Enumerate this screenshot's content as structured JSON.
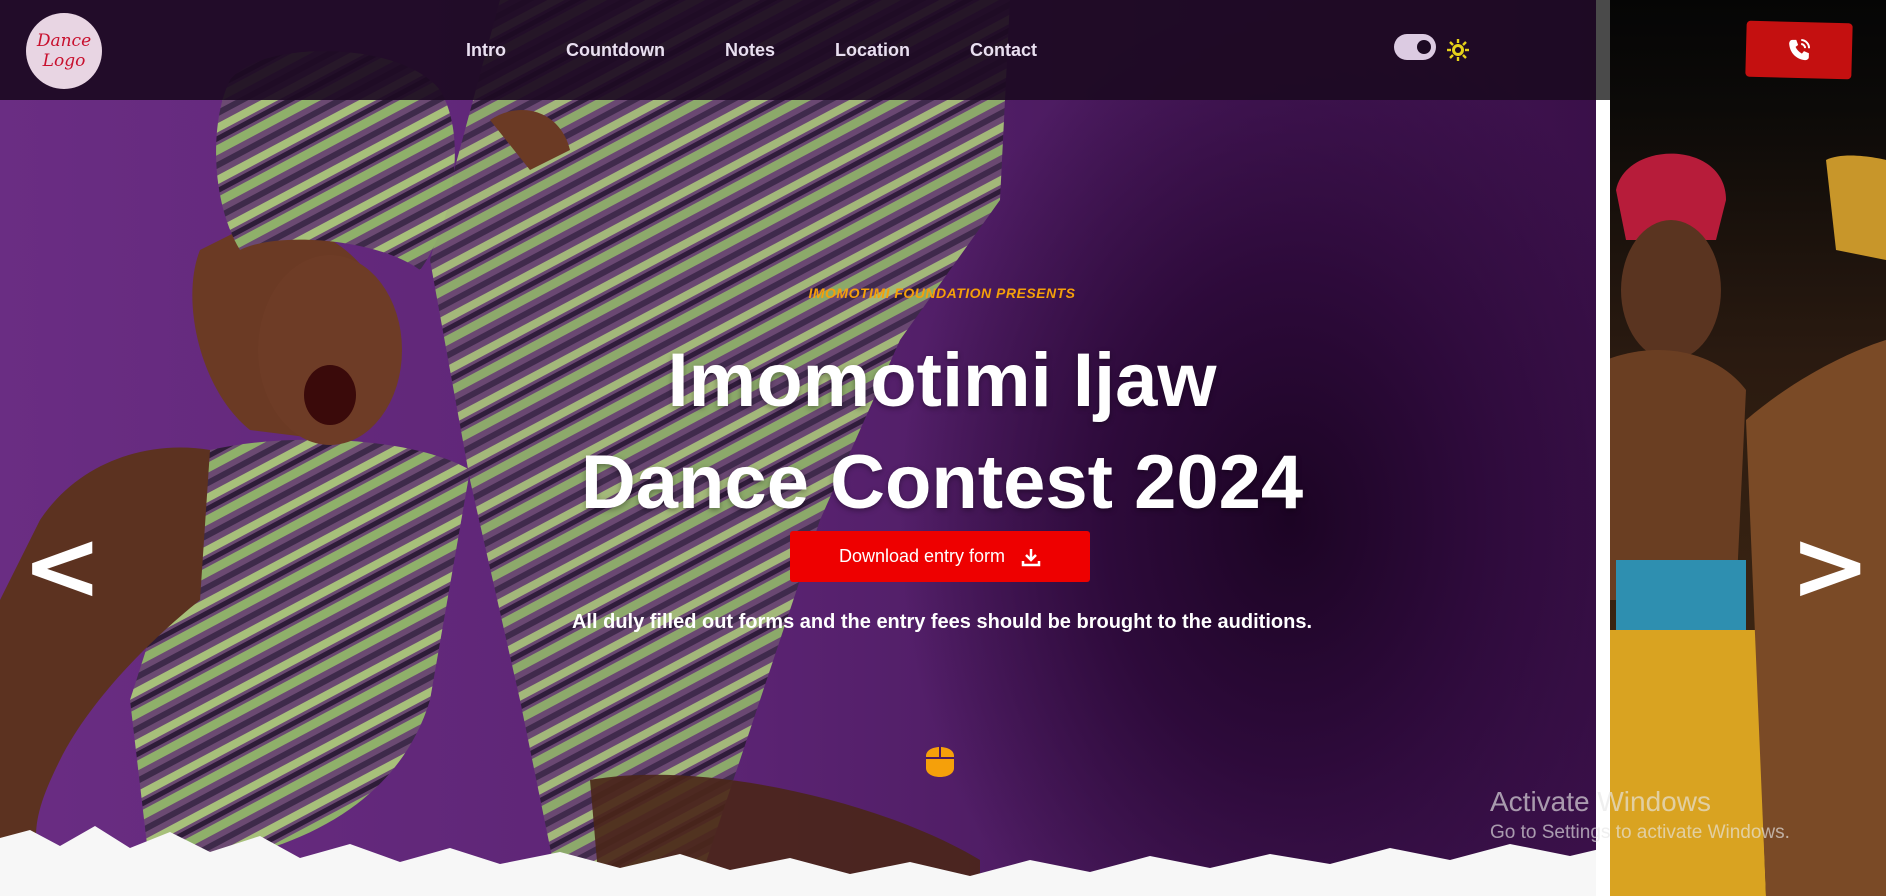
{
  "logo": {
    "line1": "Dance",
    "line2": "Logo"
  },
  "nav": {
    "items": [
      {
        "label": "Intro"
      },
      {
        "label": "Countdown"
      },
      {
        "label": "Notes"
      },
      {
        "label": "Location"
      },
      {
        "label": "Contact"
      }
    ]
  },
  "theme": {
    "toggle_icon": "toggle-switch-icon",
    "mode_icon": "sun-icon"
  },
  "call": {
    "icon": "phone-call-icon"
  },
  "hero": {
    "presents": "IMOMOTIMI FOUNDATION PRESENTS",
    "title_line1": "Imomotimi Ijaw",
    "title_line2": "Dance Contest 2024",
    "download_label": "Download entry form",
    "download_icon": "download-icon",
    "note": "All duly filled out forms and the entry fees should be brought to the auditions.",
    "scroll_icon": "mouse-icon"
  },
  "carousel": {
    "prev_label": "<",
    "next_label": ">"
  },
  "watermark": {
    "title": "Activate Windows",
    "subtitle": "Go to Settings to activate Windows."
  },
  "colors": {
    "accent_orange": "#f5a00a",
    "button_red": "#ee0000",
    "call_red": "#c41010",
    "nav_bg": "#1c0a22",
    "hero_purple": "#5c2474"
  }
}
